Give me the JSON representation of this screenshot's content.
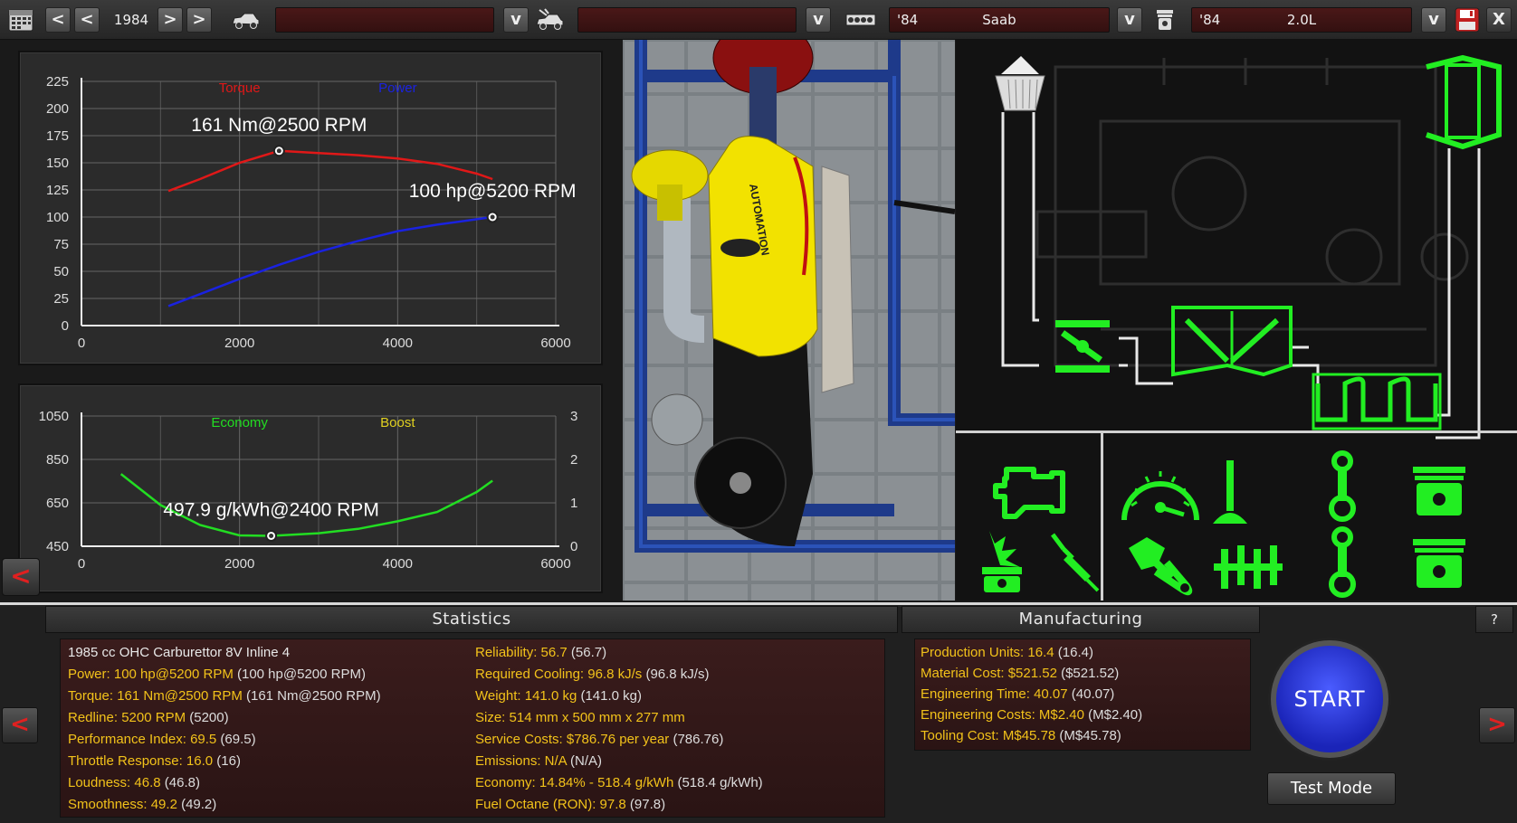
{
  "topbar": {
    "year": "1984",
    "prev2": "<",
    "prev1": "<",
    "next1": ">",
    "next2": ">",
    "car_model_field": "",
    "car_trim_field": "",
    "dropdown": "v",
    "engine_family_year": "'84",
    "engine_family_name": "Saab",
    "engine_variant_year": "'84",
    "engine_variant_name": "2.0L",
    "close": "X"
  },
  "chart_data": [
    {
      "type": "line",
      "xlim": [
        0,
        6000
      ],
      "ylim": [
        0,
        225
      ],
      "x_ticks": [
        "0",
        "2000",
        "4000",
        "6000"
      ],
      "y_ticks": [
        "0",
        "25",
        "50",
        "75",
        "100",
        "125",
        "150",
        "175",
        "200",
        "225"
      ],
      "grid": true,
      "legend": [
        "Torque",
        "Power"
      ],
      "series": [
        {
          "name": "Torque",
          "color": "#e01818",
          "x": [
            1100,
            1500,
            2000,
            2500,
            3000,
            3500,
            4000,
            4500,
            5000,
            5200
          ],
          "y": [
            124,
            135,
            150,
            161,
            159,
            157,
            154,
            149,
            140,
            135
          ]
        },
        {
          "name": "Power",
          "color": "#1a22e0",
          "x": [
            1100,
            1500,
            2000,
            2500,
            3000,
            3500,
            4000,
            4500,
            5000,
            5200
          ],
          "y": [
            18,
            29,
            43,
            56,
            68,
            78,
            87,
            93,
            98,
            100
          ]
        }
      ],
      "annotations": [
        {
          "text": "161 Nm@2500 RPM",
          "x": 2500,
          "y": 161
        },
        {
          "text": "100 hp@5200 RPM",
          "x": 5200,
          "y": 100
        }
      ]
    },
    {
      "type": "line",
      "xlim": [
        0,
        6000
      ],
      "ylim": [
        450,
        1050
      ],
      "y2lim": [
        0,
        3
      ],
      "x_ticks": [
        "0",
        "2000",
        "4000",
        "6000"
      ],
      "y_ticks": [
        "450",
        "650",
        "850",
        "1050"
      ],
      "y2_ticks": [
        "0",
        "1",
        "2",
        "3"
      ],
      "grid": true,
      "legend": [
        "Economy",
        "Boost"
      ],
      "series": [
        {
          "name": "Economy",
          "color": "#22dd22",
          "x": [
            500,
            1000,
            1500,
            2000,
            2400,
            3000,
            3500,
            4000,
            4500,
            5000,
            5200
          ],
          "y": [
            783,
            640,
            548,
            500,
            498,
            510,
            530,
            565,
            608,
            700,
            752
          ]
        },
        {
          "name": "Boost",
          "color": "#e0d020",
          "x": [],
          "y": []
        }
      ],
      "annotations": [
        {
          "text": "497.9 g/kWh@2400 RPM",
          "x": 2400,
          "y": 498
        }
      ]
    }
  ],
  "statistics": {
    "title": "Statistics",
    "header_line": "1985 cc OHC Carburettor 8V Inline 4",
    "left": [
      {
        "k": "Power: 100 hp@5200 RPM",
        "v": " (100 hp@5200 RPM)"
      },
      {
        "k": "Torque: 161 Nm@2500 RPM",
        "v": " (161 Nm@2500 RPM)"
      },
      {
        "k": "Redline: 5200 RPM",
        "v": " (5200)"
      },
      {
        "k": "Performance Index: 69.5",
        "v": " (69.5)"
      },
      {
        "k": "Throttle Response: 16.0",
        "v": " (16)"
      },
      {
        "k": "Loudness: 46.8",
        "v": " (46.8)"
      },
      {
        "k": "Smoothness: 49.2",
        "v": " (49.2)"
      }
    ],
    "right": [
      {
        "k": "Reliability: 56.7",
        "v": " (56.7)"
      },
      {
        "k": "Required Cooling: 96.8 kJ/s",
        "v": " (96.8 kJ/s)"
      },
      {
        "k": "Weight: 141.0 kg",
        "v": " (141.0 kg)"
      },
      {
        "k": "Size: 514 mm x 500 mm x 277 mm",
        "v": ""
      },
      {
        "k": "Service Costs: $786.76 per year",
        "v": " (786.76)"
      },
      {
        "k": "Emissions: N/A",
        "v": " (N/A)"
      },
      {
        "k": "Economy: 14.84% - 518.4 g/kWh",
        "v": " (518.4 g/kWh)"
      },
      {
        "k": "Fuel Octane (RON): 97.8",
        "v": " (97.8)"
      }
    ]
  },
  "manufacturing": {
    "title": "Manufacturing",
    "items": [
      {
        "k": "Production Units: 16.4",
        "v": " (16.4)"
      },
      {
        "k": "Material Cost: $521.52",
        "v": " ($521.52)"
      },
      {
        "k": "Engineering Time: 40.07",
        "v": " (40.07)"
      },
      {
        "k": "Engineering Costs: M$2.40",
        "v": " (M$2.40)"
      },
      {
        "k": "Tooling Cost: M$45.78",
        "v": " (M$45.78)"
      }
    ]
  },
  "controls": {
    "start": "START",
    "test_mode": "Test Mode",
    "help": "?",
    "back": "<",
    "forward": ">"
  },
  "engine_brand": "AUTOMATION",
  "colors": {
    "accent_yellow": "#f2c21a",
    "schematic_green": "#22ee22",
    "start_blue": "#2233dd",
    "back_red": "#e02020"
  }
}
